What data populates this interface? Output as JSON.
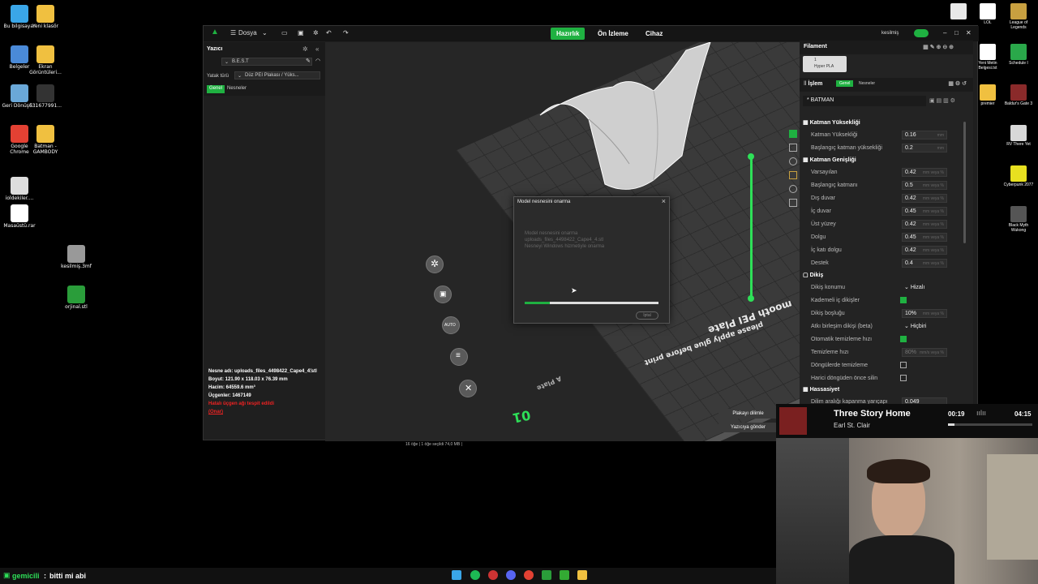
{
  "desktop_left": [
    {
      "label": "Bu bilgisayar",
      "color": "#3aa6e8"
    },
    {
      "label": "Yeni klasör",
      "color": "#f0c040"
    },
    {
      "label": "Belgeler",
      "color": "#4a8ad8"
    },
    {
      "label": "Ekran Görüntüleri...",
      "color": "#f0c040"
    },
    {
      "label": "Geri Dönüşü...",
      "color": "#6aa8d8"
    },
    {
      "label": "631677991...",
      "color": "#333333"
    },
    {
      "label": "Google Chrome",
      "color": "#e34133"
    },
    {
      "label": "Batman - GAMBODY",
      "color": "#f0c040"
    },
    {
      "label": "ioldekiler....",
      "color": "#dddddd"
    },
    {
      "label": "Masaüstü.rar",
      "color": "#ffffff"
    },
    {
      "label": "kesilmiş.3mf",
      "color": "#999999"
    },
    {
      "label": "orjinal.stl",
      "color": "#2a9d3a"
    }
  ],
  "desktop_right": [
    {
      "label": "",
      "color": "#e8e8e8"
    },
    {
      "label": "LOL",
      "color": "#ffffff"
    },
    {
      "label": "League of Legends",
      "color": "#c8a040"
    },
    {
      "label": "Yeni Metin Belgesi.txt",
      "color": "#ffffff"
    },
    {
      "label": "Schedule I",
      "color": "#2aa84a"
    },
    {
      "label": "premier",
      "color": "#f0c040"
    },
    {
      "label": "Baldur's Gate 3",
      "color": "#8a2a2a"
    },
    {
      "label": "RV There Yet",
      "color": "#d8d8d8"
    },
    {
      "label": "Cyberpunk 2077",
      "color": "#e8e020"
    },
    {
      "label": "Black Myth Wukong",
      "color": "#555555"
    }
  ],
  "titlebar": {
    "file_menu": "Dosya",
    "tabs": [
      "Hazırlık",
      "Ön İzleme",
      "Cihaz"
    ],
    "active_tab": 0,
    "user": "kesilmiş"
  },
  "printer_panel": {
    "title": "Yazıcı",
    "printer_name": "B.E.S.T",
    "bed_type_label": "Yatak türü",
    "bed_type_value": "Düz PEI Plakası / Yüks...",
    "tab_global": "Genel",
    "tab_objects": "Nesneler"
  },
  "viewport": {
    "plate_text_1": "mooth PEI Plate",
    "plate_text_2": "please apply glue before print",
    "plate_label": "A Plate",
    "plate_number": "01"
  },
  "modal": {
    "title": "Model nesnesini onarma",
    "message_lines": [
      "Model nesnesini onarma",
      "uploads_files_4498422_Cape4_4.stl",
      "Nesneyi Windows hizmetiyle onarma"
    ],
    "progress": 0.19,
    "cancel_label": "İptal"
  },
  "object_info": {
    "name": "Nesne adı: uploads_files_4498422_Cape4_4.stl",
    "size": "Boyut: 121.90 x 118.03 x 76.39 mm",
    "volume": "Hacim: 64559.6 mm³",
    "triangles": "Üçgenler: 1467149",
    "warning": "Hatalı üçgen ağı tespit edildi",
    "repair_link": "(Onar)"
  },
  "slice_buttons": {
    "slice": "Plakayı dilimle",
    "send": "Yazıcıya gönder"
  },
  "status_bar": "16 öğe  |  1 öğe seçildi  74,0 MB  |",
  "right_panel": {
    "filament_title": "Filament",
    "filament_slot": "1",
    "filament_type": "Hyper PLA",
    "process_title": "İşlem",
    "process_tab_global": "Genel",
    "process_tab_objects": "Nesneler",
    "object_name": "* BATMAN",
    "sections": {
      "layer_height": "Katman Yüksekliği",
      "line_width": "Katman Genişliği",
      "seam": "Dikiş",
      "precision": "Hassasiyet"
    },
    "layer_rows": [
      {
        "label": "Katman Yüksekliği",
        "value": "0.16",
        "unit": "mm"
      },
      {
        "label": "Başlangıç katman yüksekliği",
        "value": "0.2",
        "unit": "mm"
      }
    ],
    "width_rows": [
      {
        "label": "Varsayılan",
        "value": "0.42",
        "unit": "mm veya %"
      },
      {
        "label": "Başlangıç katmanı",
        "value": "0.5",
        "unit": "mm veya %"
      },
      {
        "label": "Dış duvar",
        "value": "0.42",
        "unit": "mm veya %"
      },
      {
        "label": "İç duvar",
        "value": "0.45",
        "unit": "mm veya %"
      },
      {
        "label": "Üst yüzey",
        "value": "0.42",
        "unit": "mm veya %"
      },
      {
        "label": "Dolgu",
        "value": "0.45",
        "unit": "mm veya %"
      },
      {
        "label": "İç katı dolgu",
        "value": "0.42",
        "unit": "mm veya %"
      },
      {
        "label": "Destek",
        "value": "0.4",
        "unit": "mm veya %"
      }
    ],
    "seam_rows": {
      "position_label": "Dikiş konumu",
      "position_value": "Hizalı",
      "staggered_label": "Kademeli iç dikişler",
      "gap_label": "Dikiş boşluğu",
      "gap_value": "10%",
      "gap_unit": "mm veya %",
      "scarf_label": "Atkı birleşim dikişi (beta)",
      "scarf_value": "Hiçbiri",
      "auto_wipe_label": "Otomatik temizleme hızı",
      "wipe_speed_label": "Temizleme hızı",
      "wipe_speed_value": "80%",
      "wipe_speed_unit": "mm/s veya %",
      "loop_wipe_label": "Döngülerde temizleme",
      "outer_wipe_label": "Harici döngüden önce silin"
    },
    "precision_row": {
      "label": "Dilim aralığı kapanma yarıçapı",
      "value": "0.049"
    }
  },
  "media": {
    "title": "Three Story Home",
    "artist": "Earl St. Clair",
    "elapsed": "00:19",
    "total": "04:15"
  },
  "chat": {
    "user": "gemicili",
    "message": "bitti mi abi"
  }
}
